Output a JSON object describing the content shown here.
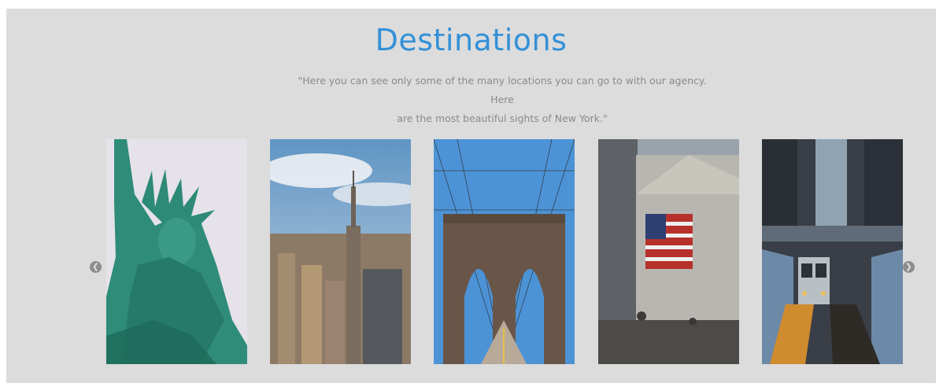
{
  "header": {
    "title": "Destinations",
    "subtitle_line1": "\"Here you can see only some of the many locations you can go to with our agency. Here",
    "subtitle_line2": "are the most beautiful sights of New York.\""
  },
  "carousel": {
    "prev_icon": "chevron-left-icon",
    "next_icon": "chevron-right-icon",
    "cards": [
      {
        "name": "statue-of-liberty"
      },
      {
        "name": "empire-state-skyline"
      },
      {
        "name": "brooklyn-bridge"
      },
      {
        "name": "stock-exchange"
      },
      {
        "name": "subway-train"
      }
    ]
  },
  "colors": {
    "accent": "#3390d6",
    "section_bg": "#dcdcdd",
    "subtitle": "#8a8a8a"
  }
}
